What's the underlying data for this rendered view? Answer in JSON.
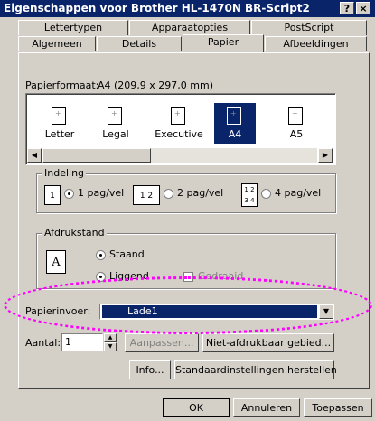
{
  "window": {
    "title": "Eigenschappen voor Brother HL-1470N BR-Script2",
    "help_label": "?",
    "close_label": "×"
  },
  "tabs_row1": [
    {
      "label": "Lettertypen"
    },
    {
      "label": "Apparaatopties"
    },
    {
      "label": "PostScript"
    }
  ],
  "tabs_row2": [
    {
      "label": "Algemeen"
    },
    {
      "label": "Details"
    },
    {
      "label": "Papier"
    },
    {
      "label": "Afbeeldingen"
    }
  ],
  "paper": {
    "format_label": "Papierformaat:",
    "format_value": "A4 (209,9 x 297,0 mm)",
    "sizes": [
      "Letter",
      "Legal",
      "Executive",
      "A4",
      "A5"
    ],
    "selected": "A4"
  },
  "layout": {
    "group_label": "Indeling",
    "options": [
      "1 pag/vel",
      "2 pag/vel",
      "4 pag/vel"
    ],
    "icon_texts": [
      "1",
      "1 2",
      "1 2 3 4"
    ],
    "selected": "1 pag/vel"
  },
  "orientation": {
    "group_label": "Afdrukstand",
    "portrait": "Staand",
    "landscape": "Liggend",
    "rotate": "Gedraaid",
    "icon_letter": "A",
    "selected": "Staand"
  },
  "source": {
    "label": "Papierinvoer:",
    "value": "Lade1"
  },
  "copies": {
    "label": "Aantal:",
    "value": "1",
    "collate": "Aanpassen...",
    "nonprint": "Niet-afdrukbaar gebied..."
  },
  "buttons": {
    "info": "Info...",
    "defaults": "Standaardinstellingen herstellen",
    "ok": "OK",
    "cancel": "Annuleren",
    "apply": "Toepassen"
  },
  "icons": {
    "scroll_left": "◀",
    "scroll_right": "▶",
    "dropdown": "▼",
    "spin_up": "▲",
    "spin_down": "▼"
  },
  "colors": {
    "titlebar": "#0a246a",
    "face": "#d4d0c8",
    "highlight": "#ff00ff"
  }
}
